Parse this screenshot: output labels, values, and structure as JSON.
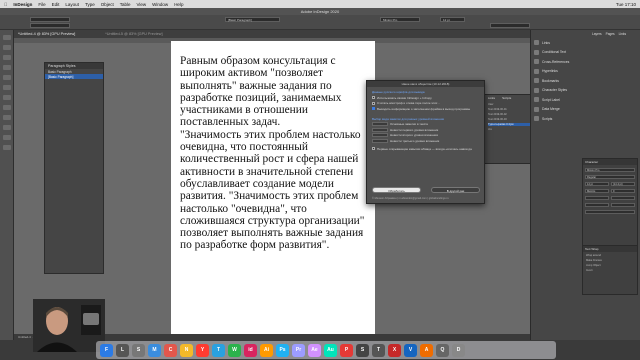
{
  "menubar": {
    "app": "InDesign",
    "items": [
      "File",
      "Edit",
      "Layout",
      "Type",
      "Object",
      "Table",
      "View",
      "Window",
      "Help"
    ],
    "clock": "Tue 17:10"
  },
  "appbar": {
    "title": "Adobe InDesign 2020"
  },
  "control": {
    "style_value": "[Basic Paragraph]",
    "font_value": "Minion Pro",
    "size_value": "12 pt"
  },
  "tabs": [
    "*Untitled-4 @ 83% [GPU Preview]",
    "*Untitled-5 @ 83% [GPU Preview]"
  ],
  "page_text": "Равным образом консультация с широким активом \"позволяет выполнять\" важные задания по разработке позиций, занимаемых участниками в отношении поставленных задач.\n\"Значимость этих проблем настолько очевидна, что постоянный количественный рост и сфера нашей активности в значительной степени обуславливает создание модели развития. \"Значимость этих проблем настолько \"очевидна\", что сложившаяся структура организации\" позволяет выполнять важные задания по разработке форм развития\".",
  "paragraph_styles": {
    "title": "Paragraph Styles",
    "items": [
      "Basic Paragraph",
      "[Basic Paragraph]"
    ],
    "selected_index": 1
  },
  "dialog": {
    "title": "Наше как в обществе (10.12.2018)",
    "section1": "Данные русского шрифта для вывода",
    "opt1": "Использовать связки InDesign + InCopy",
    "opt2": "Считать апостроф и слова тире после этих ..",
    "opt3": "Выводить информацию о заполнении фрейма в выход программы",
    "section2": "Выбор вида заметки для разных уровней вложения",
    "levels": [
      "Основные заметки в тексте",
      "Новости первого уровня вложения",
      "Новости второго уровня вложения",
      "Новости третьего уровня вложения"
    ],
    "opt4": "Первые открывающие кавычки абзаца — всегда «ёлочки» навсегда",
    "btn_ok": "Обработать",
    "btn_other": "В другой раз",
    "footer": "© Михаил Абрамкин | m.abramkin@gmail.com | globalrandings.ru"
  },
  "mid_panel": {
    "tabs": [
      "Links",
      "Scripts"
    ],
    "lines": [
      "User",
      "  Test 2019-06-01",
      "  Test 2019-06-02",
      "  Test 2019-06-03",
      "  Jsx"
    ],
    "highlighted": "Typo-ru-quotes 3.4.jsx"
  },
  "right_panel": {
    "tabs": [
      "Layers",
      "Pages",
      "Links"
    ],
    "items": [
      "Links",
      "Conditional Text",
      "Cross-References",
      "Hyperlinks",
      "Bookmarks",
      "Character Styles",
      "Script Label",
      "Data Merge",
      "Scripts"
    ]
  },
  "character_panel": {
    "title": "Character",
    "font": "Minion Pro",
    "style": "Regular",
    "size": "12 pt",
    "leading": "(14.4 pt)",
    "tracking": "0",
    "kerning": "Metrics"
  },
  "text_wrap": {
    "title": "Text Wrap",
    "lines": [
      "Wrap around",
      "Make Frames",
      "Jump Object",
      "Invert"
    ]
  },
  "status": {
    "text": "Untitled-4 · 1 · [Basic] (working) · No errors"
  },
  "dock_apps": [
    {
      "label": "F",
      "color": "#2c7be5"
    },
    {
      "label": "L",
      "color": "#555"
    },
    {
      "label": "S",
      "color": "#777"
    },
    {
      "label": "M",
      "color": "#3a8dde"
    },
    {
      "label": "C",
      "color": "#e2574c"
    },
    {
      "label": "N",
      "color": "#f3b92a"
    },
    {
      "label": "Y",
      "color": "#ff3b30"
    },
    {
      "label": "T",
      "color": "#2aa1e0"
    },
    {
      "label": "W",
      "color": "#2bb24c"
    },
    {
      "label": "id",
      "color": "#d8245f"
    },
    {
      "label": "Ai",
      "color": "#ff9a00"
    },
    {
      "label": "Ps",
      "color": "#1fb1f2"
    },
    {
      "label": "Pr",
      "color": "#9c9cff"
    },
    {
      "label": "Ae",
      "color": "#d291ff"
    },
    {
      "label": "Au",
      "color": "#00e4bb"
    },
    {
      "label": "P",
      "color": "#e53935"
    },
    {
      "label": "S",
      "color": "#444"
    },
    {
      "label": "T",
      "color": "#555"
    },
    {
      "label": "X",
      "color": "#c62828"
    },
    {
      "label": "V",
      "color": "#1565c0"
    },
    {
      "label": "A",
      "color": "#ef6c00"
    },
    {
      "label": "Q",
      "color": "#666"
    },
    {
      "label": "D",
      "color": "#888"
    }
  ]
}
